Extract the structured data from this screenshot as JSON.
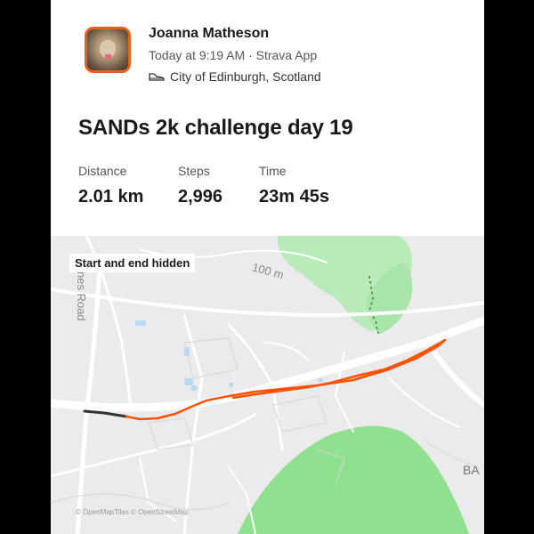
{
  "athlete": {
    "name": "Joanna Matheson",
    "meta": "Today at 9:19 AM · Strava App",
    "location": "City of Edinburgh, Scotland",
    "location_icon": "shoe-icon"
  },
  "activity": {
    "title": "SANDs 2k challenge day 19",
    "stats": [
      {
        "label": "Distance",
        "value": "2.01 km"
      },
      {
        "label": "Steps",
        "value": "2,996"
      },
      {
        "label": "Time",
        "value": "23m 45s"
      }
    ]
  },
  "map": {
    "privacy_label": "Start and end hidden",
    "road_label_1": "nes Road",
    "road_label_2": "100 m",
    "road_label_3": "BA",
    "attribution": "© OpenMapTiles © OpenStreetMap",
    "route_color": "#fc5200",
    "hidden_route_color": "#333333",
    "park_color": "#8fe08f"
  }
}
